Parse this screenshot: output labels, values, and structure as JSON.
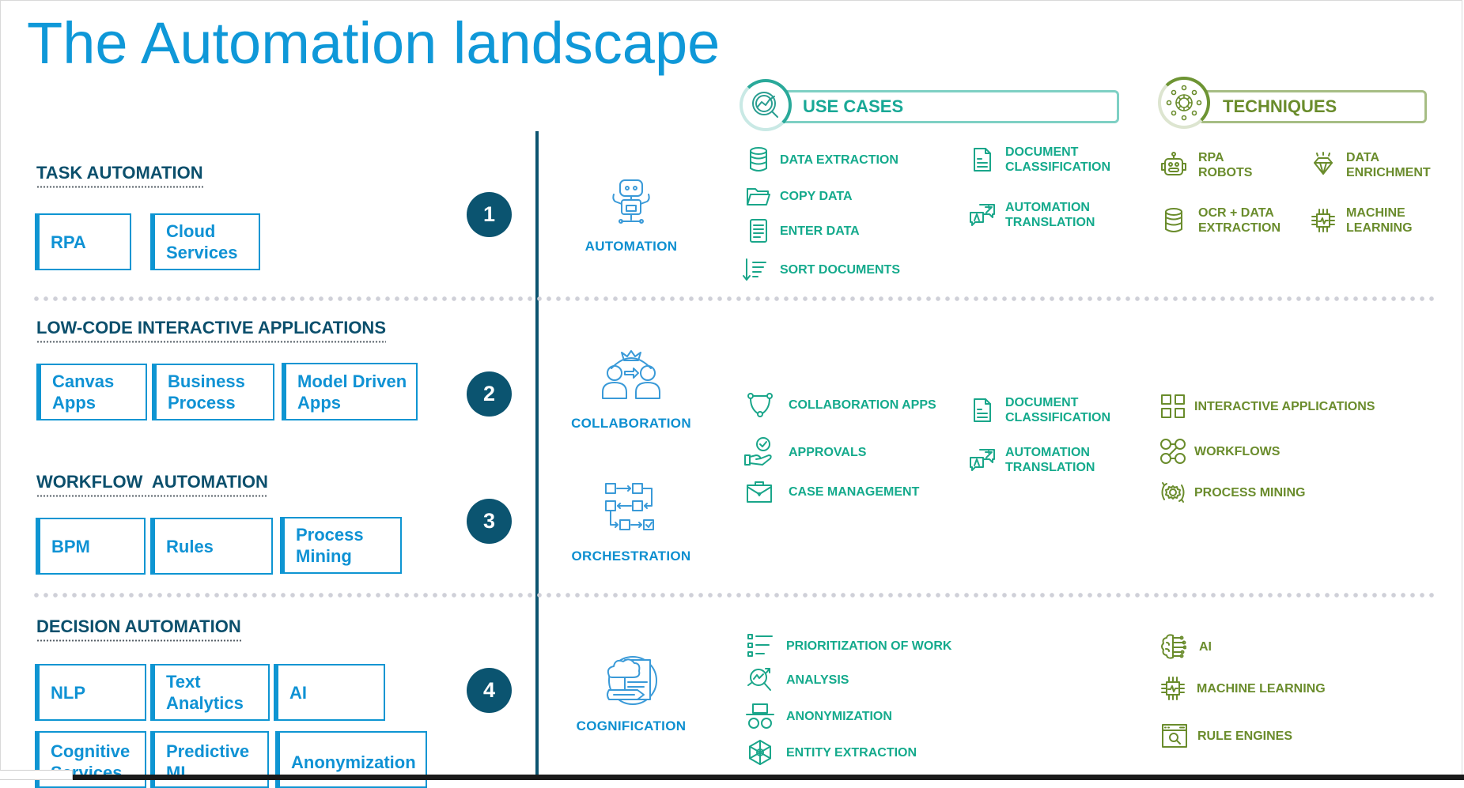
{
  "title": "The Automation landscape",
  "left_sections": [
    {
      "number": "1",
      "heading": "TASK AUTOMATION",
      "boxes": [
        {
          "label": "RPA"
        },
        {
          "label": "Cloud Services"
        }
      ]
    },
    {
      "number": "2",
      "heading": "LOW-CODE INTERACTIVE APPLICATIONS",
      "boxes": [
        {
          "label": "Canvas Apps"
        },
        {
          "label": "Business Process"
        },
        {
          "label": "Model Driven Apps"
        }
      ]
    },
    {
      "number": "3",
      "heading": "WORKFLOW  AUTOMATION",
      "boxes": [
        {
          "label": "BPM"
        },
        {
          "label": "Rules"
        },
        {
          "label": "Process Mining"
        }
      ]
    },
    {
      "number": "4",
      "heading": "DECISION AUTOMATION",
      "boxes": [
        {
          "label": "NLP"
        },
        {
          "label": "Text Analytics"
        },
        {
          "label": "AI"
        },
        {
          "label": "Cognitive Services"
        },
        {
          "label": "Predictive ML"
        },
        {
          "label": "Anonymization"
        }
      ]
    }
  ],
  "categories": [
    {
      "label": "AUTOMATION",
      "icon": "robot-icon"
    },
    {
      "label": "COLLABORATION",
      "icon": "collaboration-icon"
    },
    {
      "label": "ORCHESTRATION",
      "icon": "orchestration-flow-icon"
    },
    {
      "label": "COGNIFICATION",
      "icon": "cognification-icon"
    }
  ],
  "headers": {
    "use_cases": "USE CASES",
    "techniques": "TECHNIQUES"
  },
  "colors": {
    "title_blue": "#0f98d8",
    "heading_navy": "#0b4f6c",
    "use_case_teal": "#14aa8c",
    "technique_green": "#6a8c2c"
  },
  "automation": {
    "use_cases_col1": [
      {
        "label": "DATA EXTRACTION",
        "icon": "database-icon"
      },
      {
        "label": "COPY DATA",
        "icon": "folder-icon"
      },
      {
        "label": "ENTER DATA",
        "icon": "document-lines-icon"
      },
      {
        "label": "SORT DOCUMENTS",
        "icon": "sort-icon"
      }
    ],
    "use_cases_col2": [
      {
        "line1": "DOCUMENT",
        "line2": "CLASSIFICATION",
        "icon": "document-icon"
      },
      {
        "line1": "AUTOMATION",
        "line2": "TRANSLATION",
        "icon": "translation-icon"
      }
    ],
    "techniques": [
      {
        "line1": "RPA",
        "line2": "ROBOTS",
        "icon": "robot-head-icon"
      },
      {
        "line1": "DATA",
        "line2": "ENRICHMENT",
        "icon": "diamond-icon"
      },
      {
        "line1": "OCR + DATA",
        "line2": "EXTRACTION",
        "icon": "database-icon"
      },
      {
        "line1": "MACHINE",
        "line2": "LEARNING",
        "icon": "chip-icon"
      }
    ]
  },
  "collaboration": {
    "use_cases_col1": [
      {
        "label": "COLLABORATION APPS",
        "icon": "network-icon"
      },
      {
        "label": "APPROVALS",
        "icon": "hand-check-icon"
      },
      {
        "label": "CASE MANAGEMENT",
        "icon": "briefcase-icon"
      }
    ],
    "use_cases_col2": [
      {
        "line1": "DOCUMENT",
        "line2": "CLASSIFICATION",
        "icon": "document-icon"
      },
      {
        "line1": "AUTOMATION",
        "line2": "TRANSLATION",
        "icon": "translation-icon"
      }
    ],
    "techniques": [
      {
        "label": "INTERACTIVE APPLICATIONS",
        "icon": "grid-icon"
      },
      {
        "label": "WORKFLOWS",
        "icon": "workflow-icon"
      },
      {
        "label": "PROCESS MINING",
        "icon": "gear-cycle-icon"
      }
    ]
  },
  "cognification": {
    "use_cases": [
      {
        "label": "PRIORITIZATION OF WORK",
        "icon": "checklist-icon"
      },
      {
        "label": "ANALYSIS",
        "icon": "analysis-magnifier-icon"
      },
      {
        "label": "ANONYMIZATION",
        "icon": "incognito-icon"
      },
      {
        "label": "ENTITY EXTRACTION",
        "icon": "hexagon-icon"
      }
    ],
    "techniques": [
      {
        "label": "AI",
        "icon": "brain-circuit-icon"
      },
      {
        "label": "MACHINE LEARNING",
        "icon": "chip-icon"
      },
      {
        "label": "RULE ENGINES",
        "icon": "browser-search-icon"
      }
    ]
  }
}
